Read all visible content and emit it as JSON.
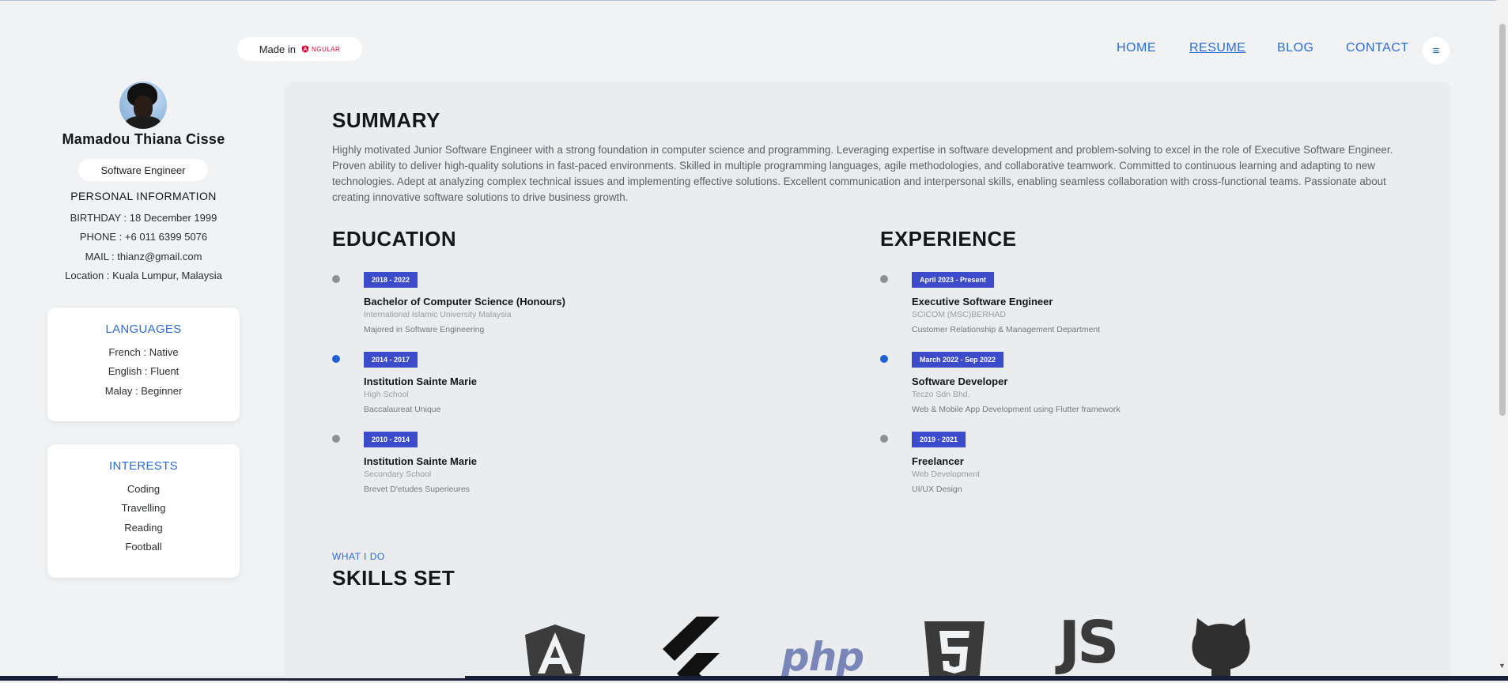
{
  "header": {
    "made_in_label": "Made in",
    "made_in_brand": "NGULAR",
    "nav": [
      {
        "label": "HOME",
        "active": false
      },
      {
        "label": "RESUME",
        "active": true
      },
      {
        "label": "BLOG",
        "active": false
      },
      {
        "label": "CONTACT",
        "active": false
      }
    ],
    "menu_icon": "hamburger-icon"
  },
  "profile": {
    "name": "Mamadou Thiana Cisse",
    "role": "Software Engineer",
    "personal_title": "PERSONAL INFORMATION",
    "birthday": "BIRTHDAY : 18 December 1999",
    "phone": "PHONE : +6 011 6399 5076",
    "mail": "MAIL : thianz@gmail.com",
    "location": "Location : Kuala Lumpur, Malaysia"
  },
  "languages": {
    "title": "LANGUAGES",
    "items": [
      "French : Native",
      "English : Fluent",
      "Malay : Beginner"
    ]
  },
  "interests": {
    "title": "INTERESTS",
    "items": [
      "Coding",
      "Travelling",
      "Reading",
      "Football"
    ]
  },
  "summary": {
    "title": "SUMMARY",
    "text": "Highly motivated Junior Software Engineer with a strong foundation in computer science and programming. Leveraging expertise in software development and problem-solving to excel in the role of Executive Software Engineer. Proven ability to deliver high-quality solutions in fast-paced environments. Skilled in multiple programming languages, agile methodologies, and collaborative teamwork. Committed to continuous learning and adapting to new technologies. Adept at analyzing complex technical issues and implementing effective solutions. Excellent communication and interpersonal skills, enabling seamless collaboration with cross-functional teams. Passionate about creating innovative software solutions to drive business growth."
  },
  "education": {
    "title": "EDUCATION",
    "items": [
      {
        "period": "2018 - 2022",
        "title": "Bachelor of Computer Science (Honours)",
        "place": "International Islamic University Malaysia",
        "desc": "Majored in Software Engineering"
      },
      {
        "period": "2014 - 2017",
        "title": "Institution Sainte Marie",
        "place": "High School",
        "desc": "Baccalaureat Unique"
      },
      {
        "period": "2010 - 2014",
        "title": "Institution Sainte Marie",
        "place": "Secondary School",
        "desc": "Brevet D'etudes Superieures"
      }
    ]
  },
  "experience": {
    "title": "EXPERIENCE",
    "items": [
      {
        "period": "April 2023 - Present",
        "title": "Executive Software Engineer",
        "place": "SCICOM (MSC)BERHAD",
        "desc": "Customer Relationship & Management Department"
      },
      {
        "period": "March 2022 - Sep 2022",
        "title": "Software Developer",
        "place": "Teczo Sdn Bhd.",
        "desc": "Web & Mobile App Development using Flutter framework"
      },
      {
        "period": "2019 - 2021",
        "title": "Freelancer",
        "place": "Web Development",
        "desc": "UI/UX Design"
      }
    ]
  },
  "skills": {
    "eyebrow": "WHAT I DO",
    "title": "SKILLS SET",
    "php_label": "php",
    "js_label": "JS",
    "icons": [
      "angular-icon",
      "flutter-icon",
      "php-icon",
      "html5-icon",
      "javascript-icon",
      "github-icon"
    ]
  },
  "colors": {
    "accent": "#2d6bd6",
    "badge": "#3b4bc9",
    "dot_active": "#1f5fd6",
    "dot_inactive": "#8f9094"
  }
}
